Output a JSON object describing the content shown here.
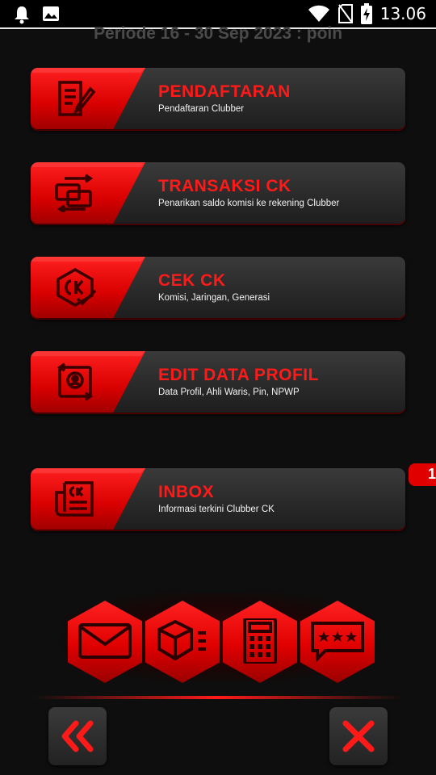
{
  "status_bar": {
    "time": "13.06",
    "left_icons": [
      "notification-bell-icon",
      "image-icon"
    ],
    "right_icons": [
      "wifi-icon",
      "no-sim-icon",
      "battery-charging-icon"
    ]
  },
  "period": {
    "text": "Periode 16 - 30 Sep 2023 : poin"
  },
  "menu": [
    {
      "title": "PENDAFTARAN",
      "subtitle": "Pendaftaran Clubber",
      "icon": "registration-form-icon"
    },
    {
      "title": "TRANSAKSI CK",
      "subtitle": "Penarikan saldo komisi ke rekening Clubber",
      "icon": "money-transfer-icon"
    },
    {
      "title": "CEK CK",
      "subtitle": "Komisi, Jaringan, Generasi",
      "icon": "ck-check-icon"
    },
    {
      "title": "EDIT DATA PROFIL",
      "subtitle": "Data Profil, Ahli Waris, Pin, NPWP",
      "icon": "edit-profile-icon"
    },
    {
      "title": "INBOX",
      "subtitle": "Informasi terkini Clubber CK",
      "icon": "inbox-newspaper-icon"
    }
  ],
  "inbox_badge": {
    "count": "1"
  },
  "hex_buttons": [
    "mail-icon",
    "product-box-icon",
    "calculator-icon",
    "password-icon"
  ],
  "nav": {
    "back_icon": "double-chevron-left-icon",
    "close_icon": "close-icon"
  },
  "colors": {
    "accent": "#e00000",
    "title_red": "#ff1a1a",
    "background": "#0e0e0e",
    "card": "#2a2a2a"
  }
}
